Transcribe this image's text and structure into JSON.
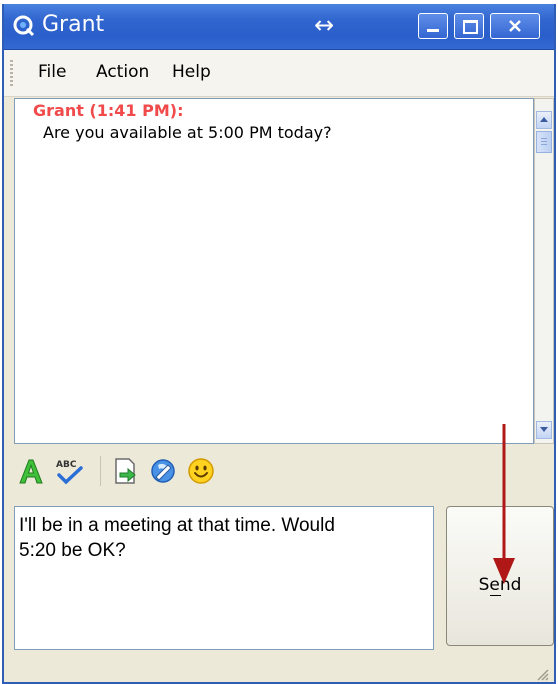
{
  "window": {
    "title": "Grant"
  },
  "menu": {
    "file": "File",
    "action": "Action",
    "help": "Help"
  },
  "conversation": {
    "sender_line": "Grant (1:41 PM):",
    "message": "Are you available at 5:00 PM today?"
  },
  "compose": {
    "text": "I'll be in a meeting at that time. Would\n5:20 be OK?"
  },
  "send_button": {
    "label": "Send"
  },
  "icons": {
    "app": "messenger-icon",
    "move": "move-horizontal-icon",
    "font": "font-icon",
    "spell": "spell-check-icon",
    "file": "send-file-icon",
    "ink": "ink-icon",
    "emoticon": "emoticon-icon"
  },
  "colors": {
    "titlebar": "#2a5fcb",
    "sender_name": "#f04a4a",
    "annotation_arrow": "#b01818"
  }
}
